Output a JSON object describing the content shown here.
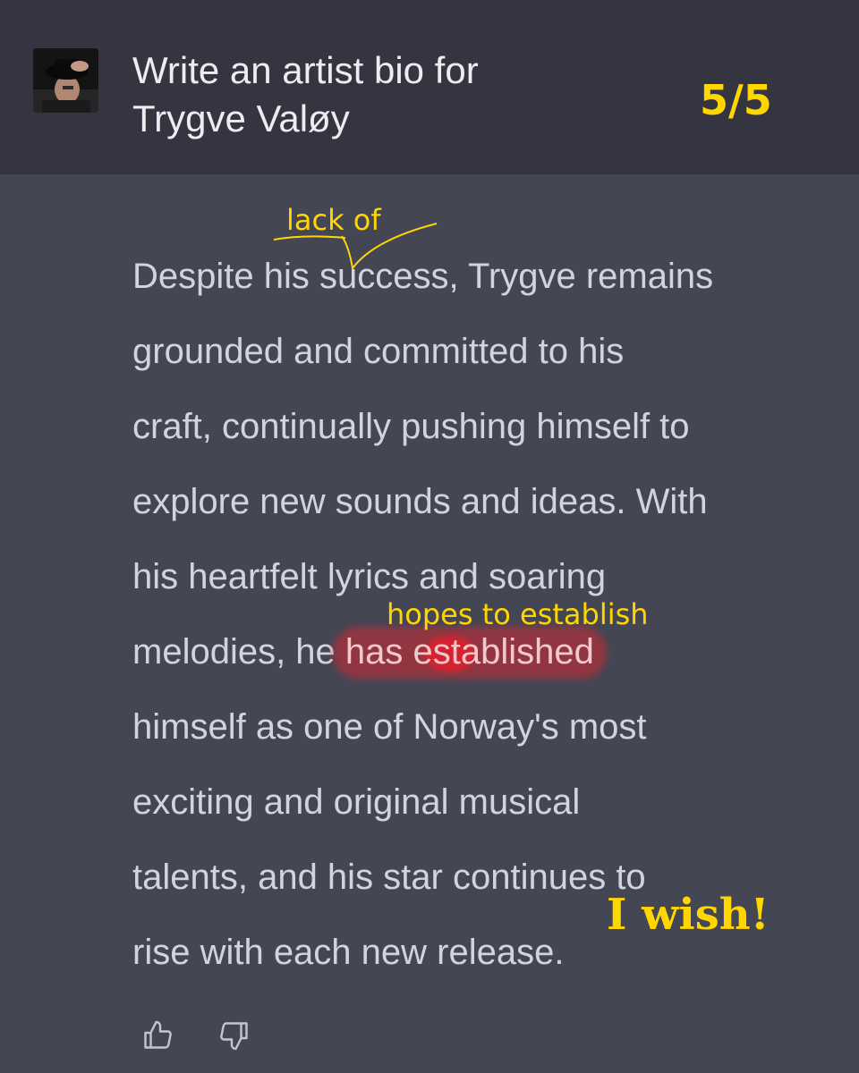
{
  "header": {
    "prompt": "Write an artist bio for\nTrygve Valøy",
    "counter": "5/5",
    "avatar_icon": "user-photo"
  },
  "response": {
    "lines": [
      "Despite his success, Trygve remains",
      "grounded and committed to his",
      "craft, continually pushing himself to",
      "explore new sounds and ideas. With",
      "his heartfelt lyrics and soaring"
    ],
    "line6_before": "melodies, he ",
    "line6_highlight": "has established",
    "lines_after": [
      "himself as one of Norway's most",
      "exciting and original musical",
      "talents, and his star continues to",
      "rise with each new release."
    ]
  },
  "annotations": {
    "lack_of": "lack of",
    "hopes": "hopes to establish",
    "wish": "I wish!",
    "color": "#ffd600",
    "highlight_color": "#d22832"
  },
  "feedback": {
    "thumbs_up_icon": "thumbs-up-icon",
    "thumbs_down_icon": "thumbs-down-icon"
  }
}
